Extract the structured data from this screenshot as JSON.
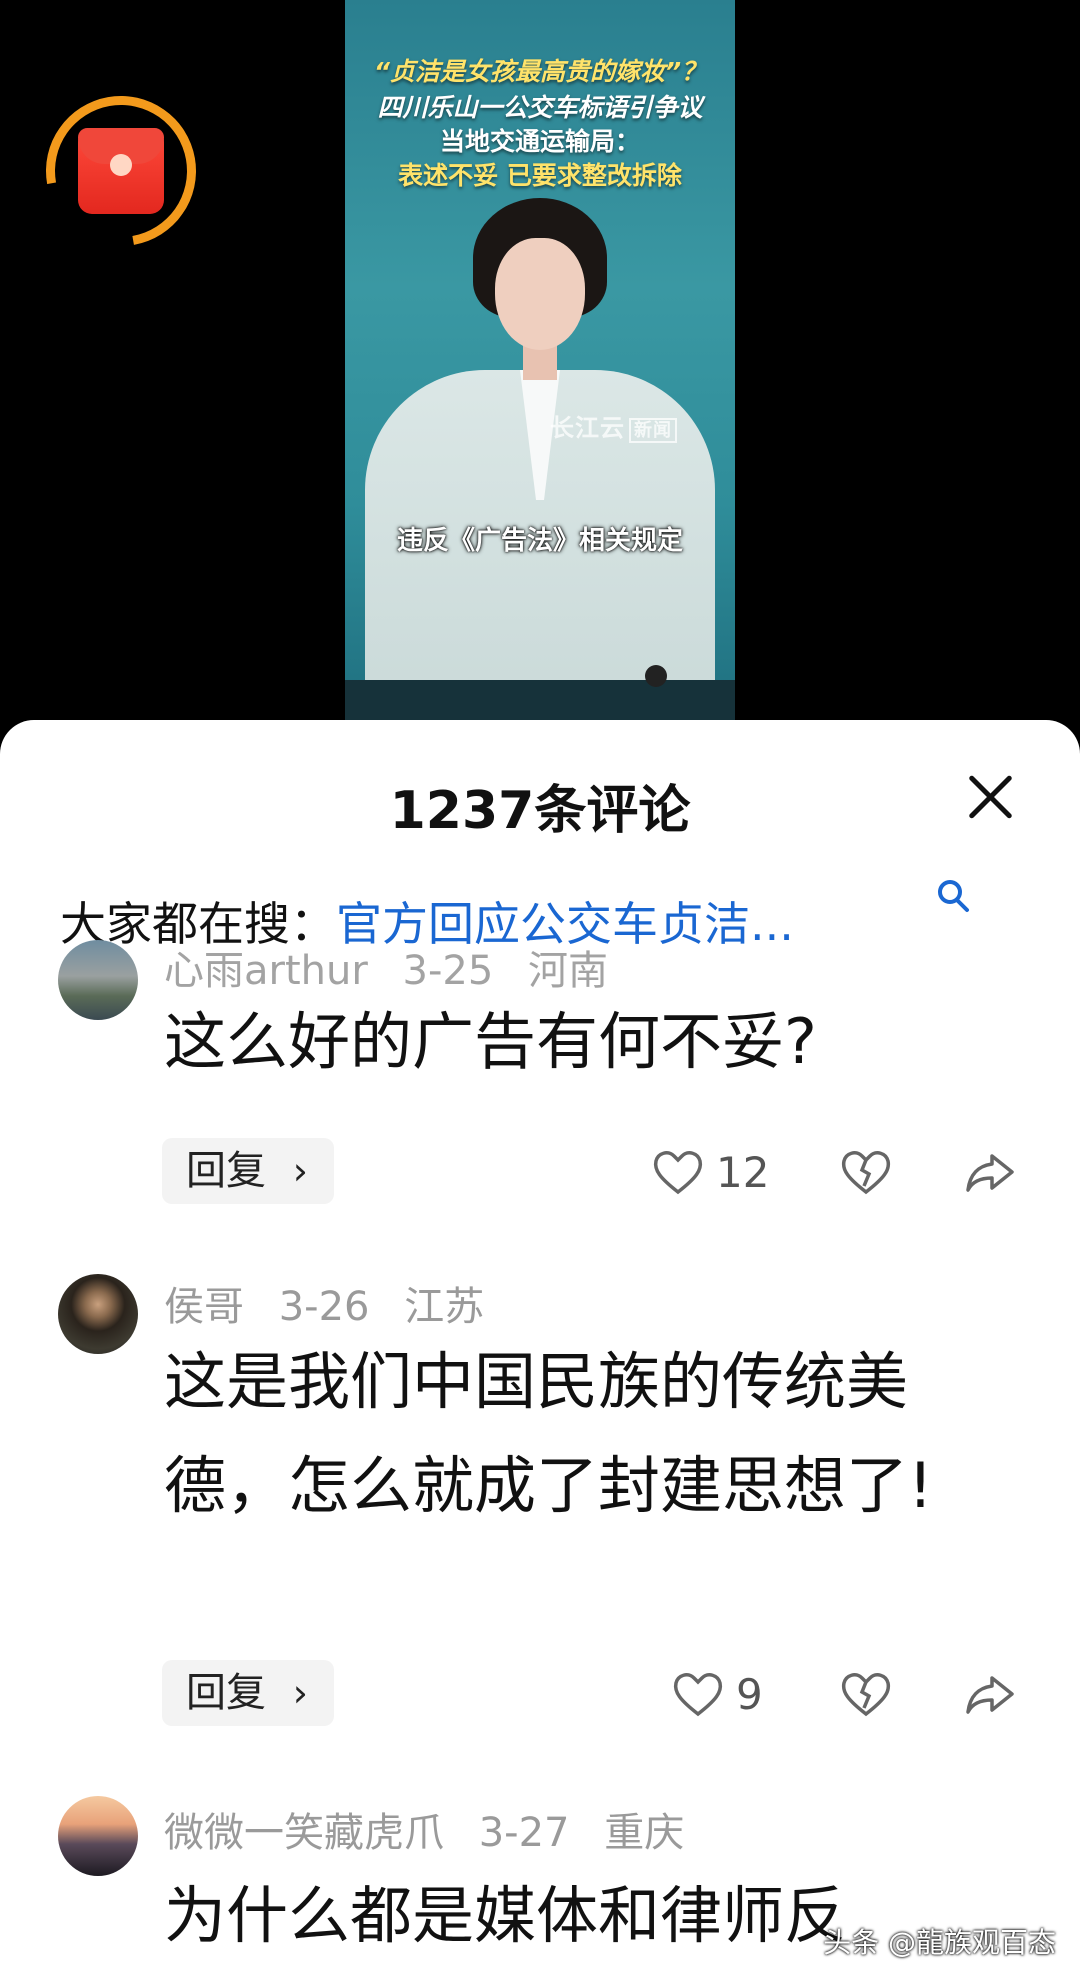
{
  "video": {
    "headlines": [
      "“贞洁是女孩最高贵的嫁妆”？",
      "四川乐山一公交车标语引争议",
      "当地交通运输局：",
      "表述不妥 已要求整改拆除"
    ],
    "watermark": {
      "brand": "长江云",
      "tag": "新闻"
    },
    "subtitle": "违反《广告法》相关规定"
  },
  "sheet": {
    "title": "1237条评论",
    "search": {
      "prefix": "大家都在搜：",
      "link": "官方回应公交车贞洁..."
    }
  },
  "comments": [
    {
      "user": "心雨arthur",
      "date": "3-25",
      "region": "河南",
      "text": "这么好的广告有何不妥?",
      "reply_label": "回复",
      "likes": "12"
    },
    {
      "user": "侯哥",
      "date": "3-26",
      "region": "江苏",
      "text": "这是我们中国民族的传统美德，怎么就成了封建思想了!",
      "reply_label": "回复",
      "likes": "9"
    },
    {
      "user": "微微一笑藏虎爪",
      "date": "3-27",
      "region": "重庆",
      "text": "为什么都是媒体和律师反",
      "reply_label": "",
      "likes": ""
    }
  ],
  "footer": {
    "watermark": "头条 @龍族观百态"
  }
}
